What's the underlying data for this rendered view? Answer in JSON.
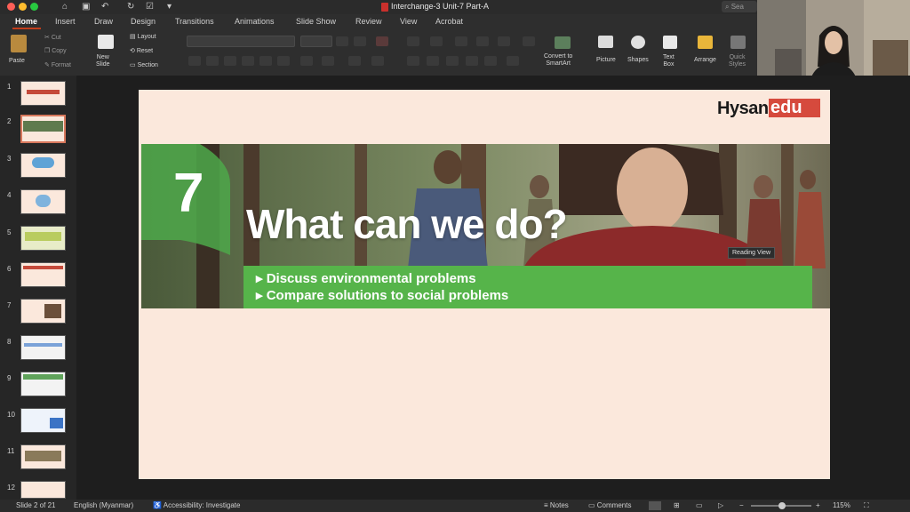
{
  "window": {
    "title": "Interchange-3 Unit-7 Part-A",
    "search_placeholder": "Sea"
  },
  "tabs": [
    "Home",
    "Insert",
    "Draw",
    "Design",
    "Transitions",
    "Animations",
    "Slide Show",
    "Review",
    "View",
    "Acrobat"
  ],
  "ribbon": {
    "paste": "Paste",
    "cut": "Cut",
    "copy": "Copy",
    "format": "Format",
    "new_slide": "New\nSlide",
    "layout": "Layout",
    "reset": "Reset",
    "section": "Section",
    "convert_smartart": "Convert to\nSmartArt",
    "picture": "Picture",
    "shapes": "Shapes",
    "text_box": "Text\nBox",
    "arrange": "Arrange",
    "quick_styles": "Quick\nStyles"
  },
  "thumbnails": [
    "1",
    "2",
    "3",
    "4",
    "5",
    "6",
    "7",
    "8",
    "9",
    "10",
    "11",
    "12"
  ],
  "slide": {
    "brand_main": "Hysan",
    "brand_accent": "edu",
    "unit_number": "7",
    "headline": "What can we do?",
    "bullets": [
      "▸ Discuss environmental problems",
      "▸ Compare solutions to social problems"
    ],
    "tooltip": "Reading View"
  },
  "status": {
    "slide_counter": "Slide 2 of 21",
    "language": "English (Myanmar)",
    "accessibility": "Accessibility: Investigate",
    "notes": "Notes",
    "comments": "Comments",
    "zoom": "115%"
  },
  "colors": {
    "accent": "#c43e1c",
    "brand_red": "#d64a3d",
    "slide_green": "#56b44a",
    "slide_bg": "#fbe8dc"
  }
}
